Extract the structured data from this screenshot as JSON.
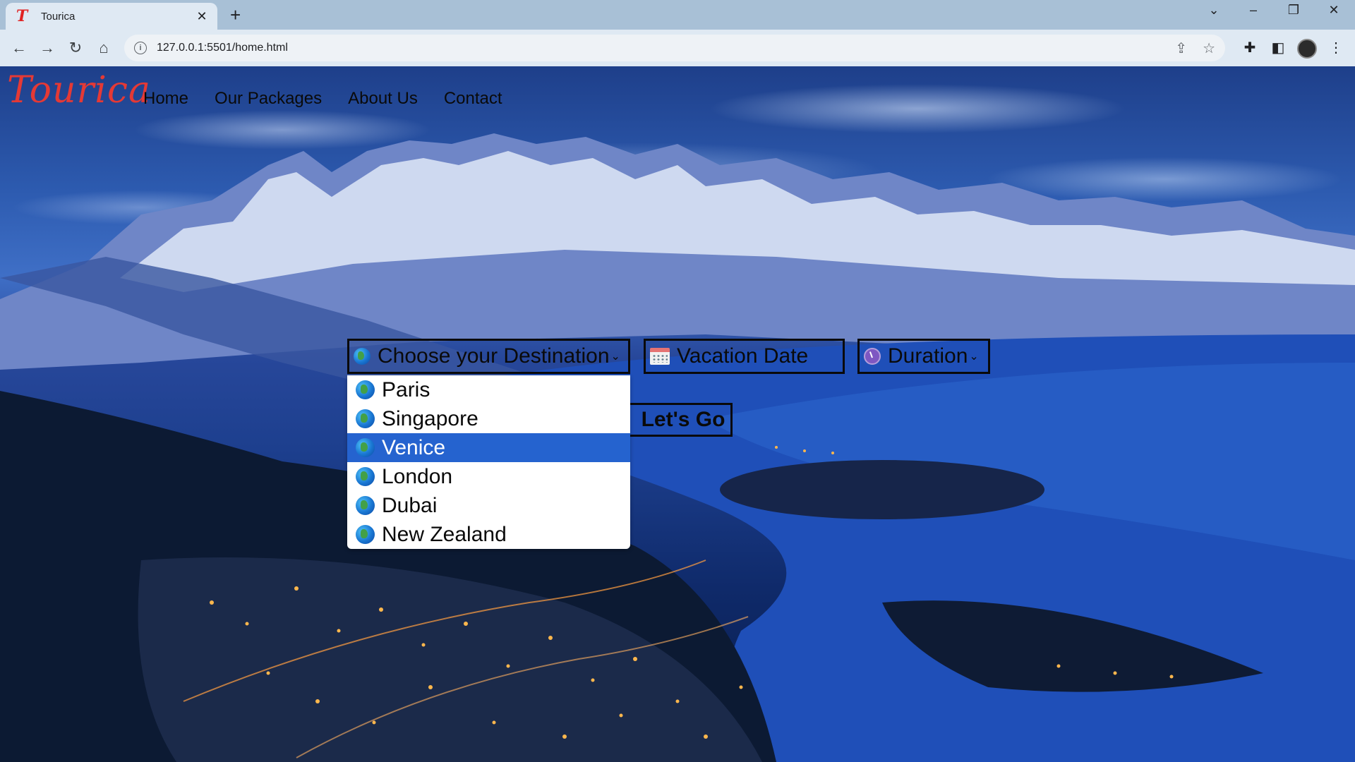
{
  "browser": {
    "tab_title": "Tourica",
    "tab_favicon": "T",
    "url": "127.0.0.1:5501/home.html"
  },
  "site": {
    "logo": "Tourica",
    "nav": [
      "Home",
      "Our Packages",
      "About Us",
      "Contact"
    ]
  },
  "search": {
    "destination_label": "Choose your Destination",
    "date_label": "Vacation Date",
    "duration_label": "Duration",
    "submit_label": "Let's Go"
  },
  "destination_options": [
    {
      "label": "Paris",
      "selected": false
    },
    {
      "label": "Singapore",
      "selected": false
    },
    {
      "label": "Venice",
      "selected": true
    },
    {
      "label": "London",
      "selected": false
    },
    {
      "label": "Dubai",
      "selected": false
    },
    {
      "label": "New Zealand",
      "selected": false
    }
  ],
  "icons": {
    "destination": "globe-icon",
    "date": "calendar-icon",
    "duration": "clock-icon"
  },
  "colors": {
    "logo": "#e53935",
    "selected_option": "#2563cf"
  }
}
